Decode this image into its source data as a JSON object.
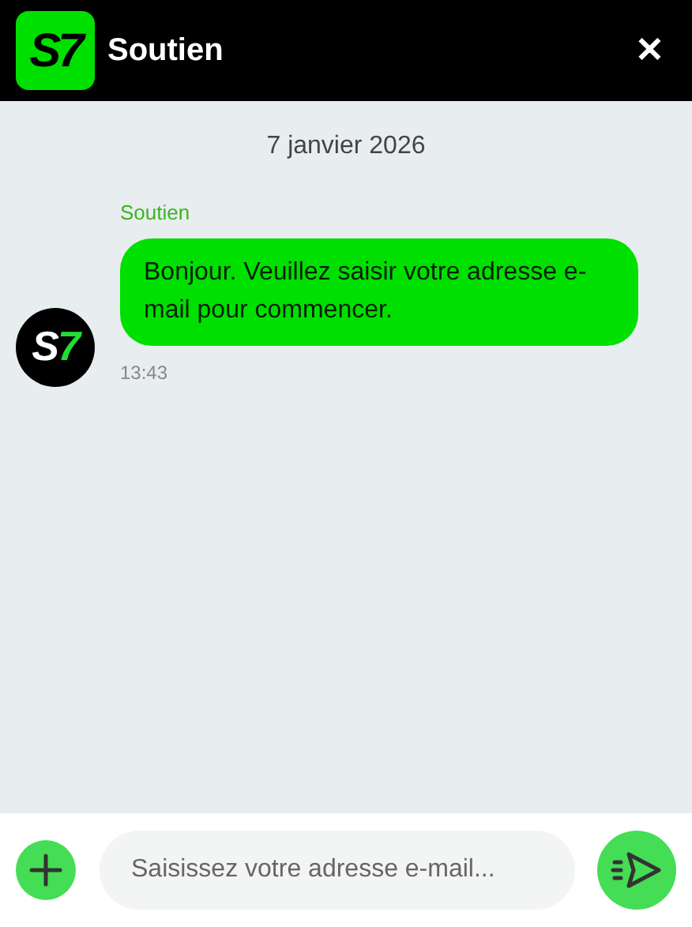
{
  "header": {
    "logo": "S7",
    "title": "Soutien",
    "close": "✕"
  },
  "date": "7 janvier 2026",
  "messages": [
    {
      "sender": "Soutien",
      "avatar_letter": "S",
      "avatar_digit": "7",
      "text": "Bonjour. Veuillez saisir votre adresse e-mail pour commencer.",
      "time": "13:43"
    }
  ],
  "composer": {
    "placeholder": "Saisissez votre adresse e-mail..."
  }
}
